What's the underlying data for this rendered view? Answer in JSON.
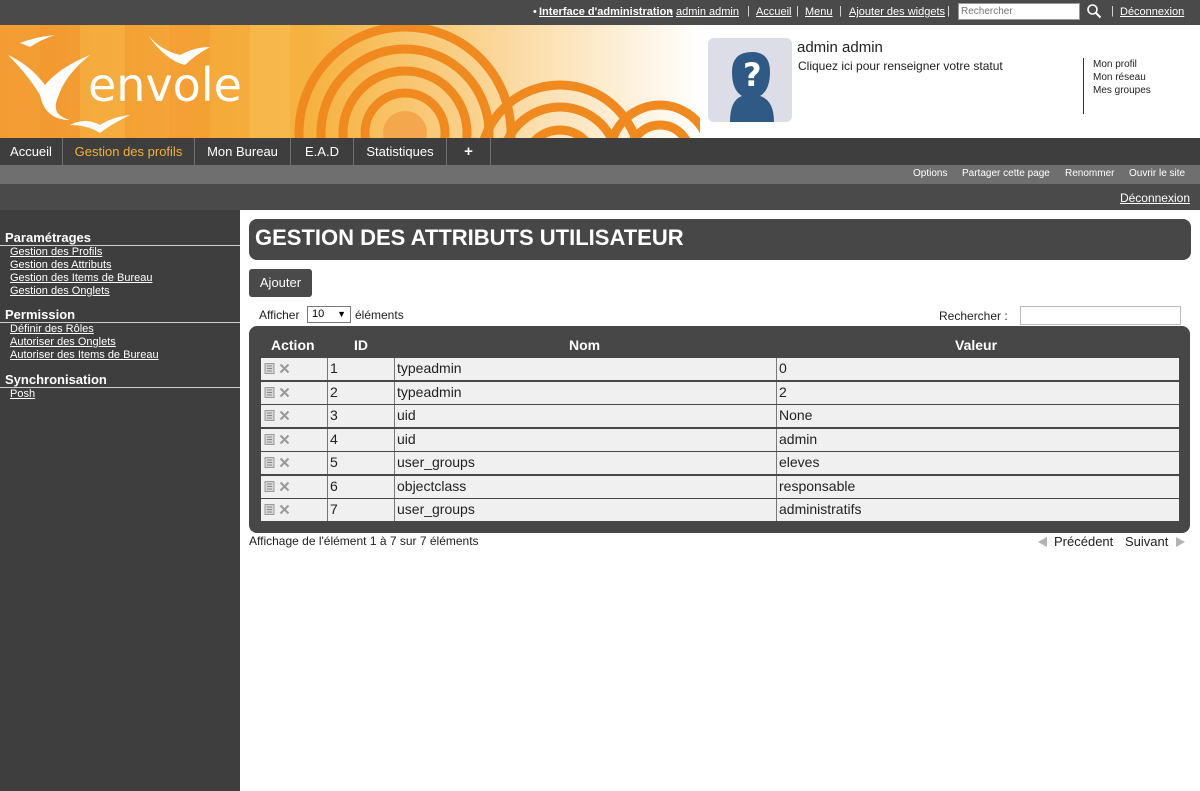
{
  "topbar": {
    "admin_interface": "Interface d'administration",
    "user": "admin admin",
    "links": [
      "Accueil",
      "Menu",
      "Ajouter des widgets"
    ],
    "search_placeholder": "Rechercher",
    "logout": "Déconnexion"
  },
  "header": {
    "logo_text": "envole",
    "profile_name": "admin admin",
    "profile_status": "Cliquez ici pour renseigner votre statut",
    "profile_links": [
      "Mon profil",
      "Mon réseau",
      "Mes groupes"
    ]
  },
  "nav": {
    "tabs": [
      "Accueil",
      "Gestion des profils",
      "Mon Bureau",
      "E.A.D",
      "Statistiques",
      "+"
    ],
    "active_index": 1
  },
  "subbar": {
    "options": [
      "Options",
      "Partager cette page",
      "Renommer",
      "Ouvrir le site"
    ],
    "logout": "Déconnexion"
  },
  "sidebar": {
    "sections": [
      {
        "title": "Paramétrages",
        "links": [
          "Gestion des Profils",
          "Gestion des Attributs",
          "Gestion des Items de Bureau",
          "Gestion des Onglets"
        ]
      },
      {
        "title": "Permission",
        "links": [
          "Définir des Rôles",
          "Autoriser des Onglets",
          "Autoriser des Items de Bureau"
        ]
      },
      {
        "title": "Synchronisation",
        "links": [
          "Posh"
        ]
      }
    ]
  },
  "main": {
    "title": "GESTION DES ATTRIBUTS UTILISATEUR",
    "add_button": "Ajouter",
    "show_prefix": "Afficher",
    "show_value": "10",
    "show_suffix": "éléments",
    "search_label": "Rechercher :",
    "table": {
      "headers": [
        "Action",
        "ID",
        "Nom",
        "Valeur"
      ],
      "rows": [
        {
          "id": "1",
          "nom": "typeadmin",
          "valeur": "0"
        },
        {
          "id": "2",
          "nom": "typeadmin",
          "valeur": "2"
        },
        {
          "id": "3",
          "nom": "uid",
          "valeur": "None"
        },
        {
          "id": "4",
          "nom": "uid",
          "valeur": "admin"
        },
        {
          "id": "5",
          "nom": "user_groups",
          "valeur": "eleves"
        },
        {
          "id": "6",
          "nom": "objectclass",
          "valeur": "responsable"
        },
        {
          "id": "7",
          "nom": "user_groups",
          "valeur": "administratifs"
        }
      ]
    },
    "info": "Affichage de l'élément 1 à 7 sur 7 éléments",
    "prev": "Précédent",
    "next": "Suivant"
  },
  "colors": {
    "dark_bar": "#3e3e3e",
    "accent_orange": "#f2b233",
    "row_bg": "#f0f0f0"
  },
  "icons": [
    "search-icon",
    "edit-icon",
    "delete-icon",
    "previous-arrow-icon",
    "next-arrow-icon",
    "avatar-placeholder-icon"
  ]
}
